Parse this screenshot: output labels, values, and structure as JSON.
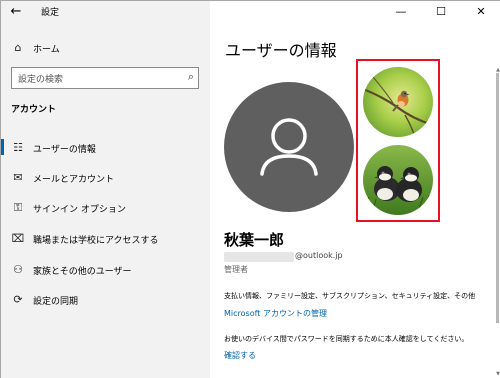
{
  "window": {
    "title": "設定",
    "back_icon": "←",
    "minimize_icon": "—",
    "maximize_icon": "☐",
    "close_icon": "✕"
  },
  "sidebar": {
    "home": {
      "icon": "⌂",
      "label": "ホーム"
    },
    "search": {
      "placeholder": "設定の検索",
      "icon": "⌕"
    },
    "section_title": "アカウント",
    "items": [
      {
        "icon": "☷",
        "label": "ユーザーの情報",
        "active": true
      },
      {
        "icon": "✉",
        "label": "メールとアカウント",
        "active": false
      },
      {
        "icon": "⚿",
        "label": "サインイン オプション",
        "active": false
      },
      {
        "icon": "⌧",
        "label": "職場または学校にアクセスする",
        "active": false
      },
      {
        "icon": "⚇",
        "label": "家族とその他のユーザー",
        "active": false
      },
      {
        "icon": "⟳",
        "label": "設定の同期",
        "active": false
      }
    ]
  },
  "main": {
    "title": "ユーザーの情報",
    "user_name": "秋葉一郎",
    "email_domain": "@outlook.jp",
    "role": "管理者",
    "info_text": "支払い情報、ファミリー設定、サブスクリプション、セキュリティ設定、その他",
    "manage_link": "Microsoft アカウントの管理",
    "sync_text": "お使いのデバイス間でパスワードを同期するために本人確認をしてください。",
    "verify_link": "確認する",
    "highlight_color": "#e81123",
    "accent_color": "#0063b1"
  }
}
